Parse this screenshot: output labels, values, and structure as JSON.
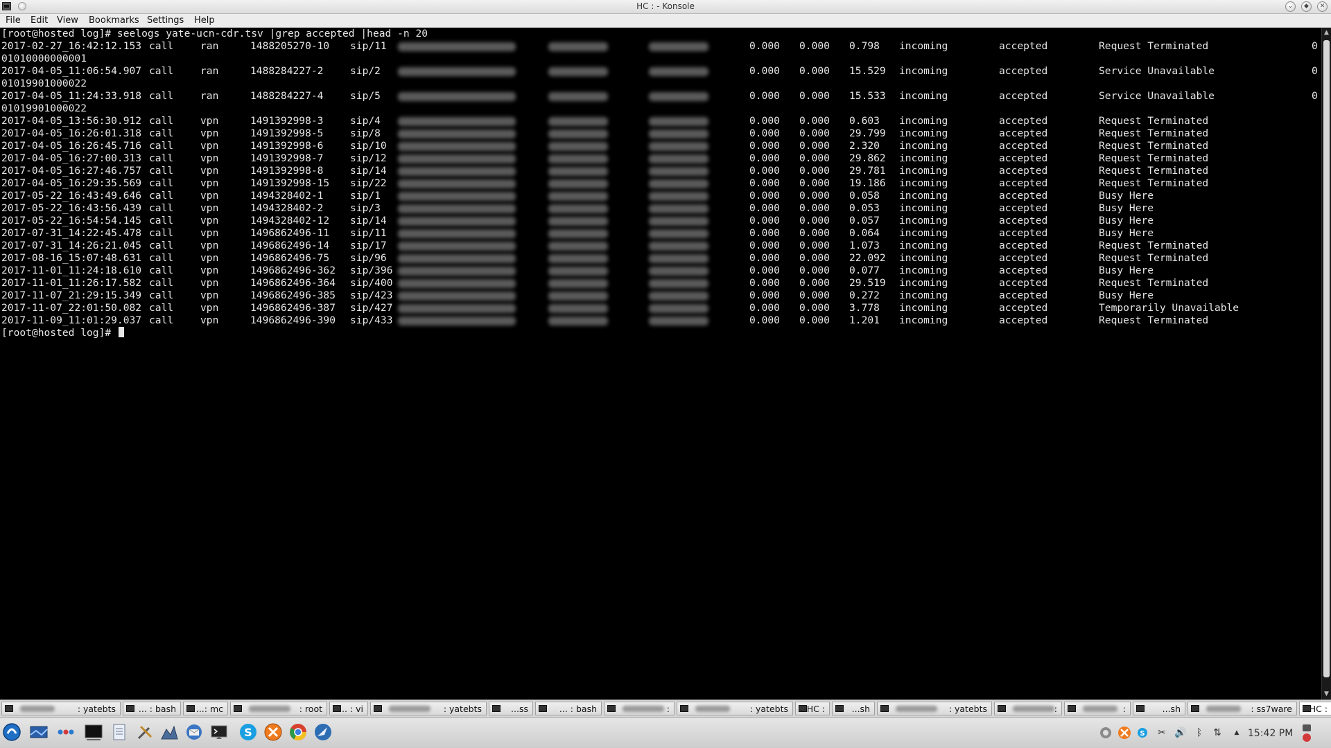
{
  "window": {
    "title": "HC : - Konsole",
    "buttons": [
      "minimize",
      "maximize",
      "close"
    ]
  },
  "menu": [
    "File",
    "Edit",
    "View",
    "Bookmarks",
    "Settings",
    "Help"
  ],
  "terminal": {
    "command_line": "[root@hosted log]# seelogs yate-ucn-cdr.tsv |grep accepted |head -n 20",
    "prompt": "[root@hosted log]# ",
    "wrap_lines": [
      "01010000000001",
      "01019901000022",
      "01019901000022"
    ],
    "rows": [
      {
        "time": "2017-02-27_16:42:12.153",
        "type": "call",
        "net": "ran",
        "id": "1488205270-10",
        "chan": "sip/11",
        "d1": "0.000",
        "d2": "0.000",
        "d3": "0.798",
        "dir": "incoming",
        "status": "accepted",
        "reason": "Request Terminated",
        "tail": "0"
      },
      {
        "time": "2017-04-05_11:06:54.907",
        "type": "call",
        "net": "ran",
        "id": "1488284227-2",
        "chan": "sip/2",
        "d1": "0.000",
        "d2": "0.000",
        "d3": "15.529",
        "dir": "incoming",
        "status": "accepted",
        "reason": "Service Unavailable",
        "tail": "0"
      },
      {
        "time": "2017-04-05_11:24:33.918",
        "type": "call",
        "net": "ran",
        "id": "1488284227-4",
        "chan": "sip/5",
        "d1": "0.000",
        "d2": "0.000",
        "d3": "15.533",
        "dir": "incoming",
        "status": "accepted",
        "reason": "Service Unavailable",
        "tail": "0"
      },
      {
        "time": "2017-04-05_13:56:30.912",
        "type": "call",
        "net": "vpn",
        "id": "1491392998-3",
        "chan": "sip/4",
        "d1": "0.000",
        "d2": "0.000",
        "d3": "0.603",
        "dir": "incoming",
        "status": "accepted",
        "reason": "Request Terminated",
        "tail": ""
      },
      {
        "time": "2017-04-05_16:26:01.318",
        "type": "call",
        "net": "vpn",
        "id": "1491392998-5",
        "chan": "sip/8",
        "d1": "0.000",
        "d2": "0.000",
        "d3": "29.799",
        "dir": "incoming",
        "status": "accepted",
        "reason": "Request Terminated",
        "tail": ""
      },
      {
        "time": "2017-04-05_16:26:45.716",
        "type": "call",
        "net": "vpn",
        "id": "1491392998-6",
        "chan": "sip/10",
        "d1": "0.000",
        "d2": "0.000",
        "d3": "2.320",
        "dir": "incoming",
        "status": "accepted",
        "reason": "Request Terminated",
        "tail": ""
      },
      {
        "time": "2017-04-05_16:27:00.313",
        "type": "call",
        "net": "vpn",
        "id": "1491392998-7",
        "chan": "sip/12",
        "d1": "0.000",
        "d2": "0.000",
        "d3": "29.862",
        "dir": "incoming",
        "status": "accepted",
        "reason": "Request Terminated",
        "tail": ""
      },
      {
        "time": "2017-04-05_16:27:46.757",
        "type": "call",
        "net": "vpn",
        "id": "1491392998-8",
        "chan": "sip/14",
        "d1": "0.000",
        "d2": "0.000",
        "d3": "29.781",
        "dir": "incoming",
        "status": "accepted",
        "reason": "Request Terminated",
        "tail": ""
      },
      {
        "time": "2017-04-05_16:29:35.569",
        "type": "call",
        "net": "vpn",
        "id": "1491392998-15",
        "chan": "sip/22",
        "d1": "0.000",
        "d2": "0.000",
        "d3": "19.186",
        "dir": "incoming",
        "status": "accepted",
        "reason": "Request Terminated",
        "tail": ""
      },
      {
        "time": "2017-05-22_16:43:49.646",
        "type": "call",
        "net": "vpn",
        "id": "1494328402-1",
        "chan": "sip/1",
        "d1": "0.000",
        "d2": "0.000",
        "d3": "0.058",
        "dir": "incoming",
        "status": "accepted",
        "reason": "Busy Here",
        "tail": ""
      },
      {
        "time": "2017-05-22_16:43:56.439",
        "type": "call",
        "net": "vpn",
        "id": "1494328402-2",
        "chan": "sip/3",
        "d1": "0.000",
        "d2": "0.000",
        "d3": "0.053",
        "dir": "incoming",
        "status": "accepted",
        "reason": "Busy Here",
        "tail": ""
      },
      {
        "time": "2017-05-22_16:54:54.145",
        "type": "call",
        "net": "vpn",
        "id": "1494328402-12",
        "chan": "sip/14",
        "d1": "0.000",
        "d2": "0.000",
        "d3": "0.057",
        "dir": "incoming",
        "status": "accepted",
        "reason": "Busy Here",
        "tail": ""
      },
      {
        "time": "2017-07-31_14:22:45.478",
        "type": "call",
        "net": "vpn",
        "id": "1496862496-11",
        "chan": "sip/11",
        "d1": "0.000",
        "d2": "0.000",
        "d3": "0.064",
        "dir": "incoming",
        "status": "accepted",
        "reason": "Busy Here",
        "tail": ""
      },
      {
        "time": "2017-07-31_14:26:21.045",
        "type": "call",
        "net": "vpn",
        "id": "1496862496-14",
        "chan": "sip/17",
        "d1": "0.000",
        "d2": "0.000",
        "d3": "1.073",
        "dir": "incoming",
        "status": "accepted",
        "reason": "Request Terminated",
        "tail": ""
      },
      {
        "time": "2017-08-16_15:07:48.631",
        "type": "call",
        "net": "vpn",
        "id": "1496862496-75",
        "chan": "sip/96",
        "d1": "0.000",
        "d2": "0.000",
        "d3": "22.092",
        "dir": "incoming",
        "status": "accepted",
        "reason": "Request Terminated",
        "tail": ""
      },
      {
        "time": "2017-11-01_11:24:18.610",
        "type": "call",
        "net": "vpn",
        "id": "1496862496-362",
        "chan": "sip/396",
        "d1": "0.000",
        "d2": "0.000",
        "d3": "0.077",
        "dir": "incoming",
        "status": "accepted",
        "reason": "Busy Here",
        "tail": ""
      },
      {
        "time": "2017-11-01_11:26:17.582",
        "type": "call",
        "net": "vpn",
        "id": "1496862496-364",
        "chan": "sip/400",
        "d1": "0.000",
        "d2": "0.000",
        "d3": "29.519",
        "dir": "incoming",
        "status": "accepted",
        "reason": "Request Terminated",
        "tail": ""
      },
      {
        "time": "2017-11-07_21:29:15.349",
        "type": "call",
        "net": "vpn",
        "id": "1496862496-385",
        "chan": "sip/423",
        "d1": "0.000",
        "d2": "0.000",
        "d3": "0.272",
        "dir": "incoming",
        "status": "accepted",
        "reason": "Busy Here",
        "tail": ""
      },
      {
        "time": "2017-11-07_22:01:50.082",
        "type": "call",
        "net": "vpn",
        "id": "1496862496-387",
        "chan": "sip/427",
        "d1": "0.000",
        "d2": "0.000",
        "d3": "3.778",
        "dir": "incoming",
        "status": "accepted",
        "reason": "Temporarily Unavailable",
        "tail": ""
      },
      {
        "time": "2017-11-09_11:01:29.037",
        "type": "call",
        "net": "vpn",
        "id": "1496862496-390",
        "chan": "sip/433",
        "d1": "0.000",
        "d2": "0.000",
        "d3": "1.201",
        "dir": "incoming",
        "status": "accepted",
        "reason": "Request Terminated",
        "tail": ""
      }
    ]
  },
  "session_tabs": [
    {
      "label": ": yatebts",
      "active": false
    },
    {
      "label": "... : bash",
      "active": false
    },
    {
      "label": "...: mc",
      "active": false
    },
    {
      "label": ": root",
      "active": false
    },
    {
      "label": "... : vi",
      "active": false
    },
    {
      "label": ": yatebts",
      "active": false
    },
    {
      "label": "...ss",
      "active": false
    },
    {
      "label": "... : bash",
      "active": false
    },
    {
      "label": ":",
      "active": false
    },
    {
      "label": ": yatebts",
      "active": false
    },
    {
      "label": "HC :",
      "active": false
    },
    {
      "label": "...sh",
      "active": false
    },
    {
      "label": ": yatebts",
      "active": false
    },
    {
      "label": ":",
      "active": false
    },
    {
      "label": ":",
      "active": false
    },
    {
      "label": "...sh",
      "active": false
    },
    {
      "label": ": ss7ware",
      "active": false
    },
    {
      "label": "HC :",
      "active": true
    }
  ],
  "taskbar": {
    "launchers": [
      "kde-menu-icon",
      "desktop-icon",
      "activities-icon",
      "terminal-icon",
      "notes-icon",
      "tools-icon",
      "network-icon",
      "thunderbird-icon",
      "konsole-icon",
      "skype-icon",
      "xampp-icon",
      "chrome-icon",
      "browser-icon"
    ],
    "tray": [
      "network-manager-icon",
      "xampp-tray-icon",
      "skype-tray-icon",
      "tools-tray-icon",
      "volume-icon",
      "bluetooth-icon",
      "usb-icon",
      "tray-expand-icon"
    ],
    "clock": "15:42 PM"
  },
  "colors": {
    "terminal_bg": "#000000",
    "terminal_fg": "#e6e6e6"
  }
}
